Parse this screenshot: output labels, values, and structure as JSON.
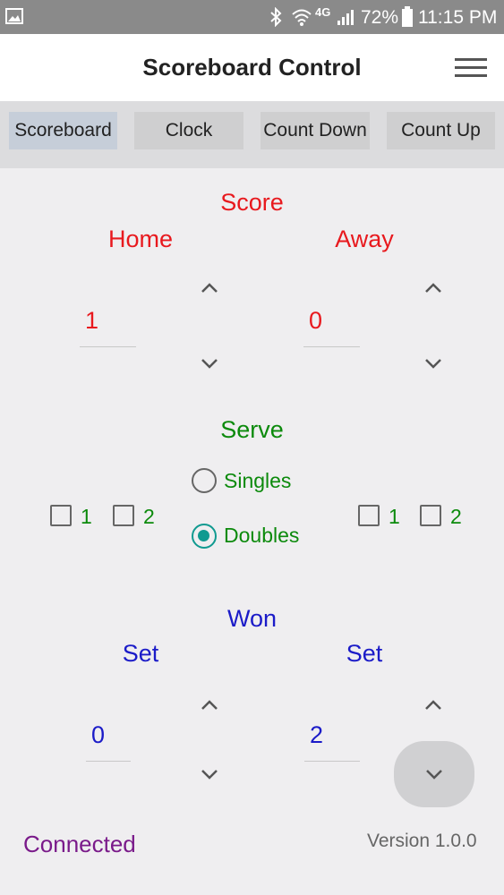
{
  "status_bar": {
    "icons": [
      "gallery-icon",
      "bluetooth-icon",
      "wifi-icon",
      "signal-4g-icon",
      "battery-icon"
    ],
    "network": "4G",
    "battery": "72%",
    "time": "11:15 PM"
  },
  "app_bar": {
    "title": "Scoreboard Control"
  },
  "tabs": [
    {
      "label": "Scoreboard",
      "active": true
    },
    {
      "label": "Clock",
      "active": false
    },
    {
      "label": "Count Down",
      "active": false
    },
    {
      "label": "Count Up",
      "active": false
    }
  ],
  "score": {
    "heading": "Score",
    "home_label": "Home",
    "away_label": "Away",
    "home_value": "1",
    "away_value": "0"
  },
  "serve": {
    "heading": "Serve",
    "singles_label": "Singles",
    "doubles_label": "Doubles",
    "selected": "Doubles",
    "home_checks": [
      {
        "label": "1",
        "checked": false
      },
      {
        "label": "2",
        "checked": false
      }
    ],
    "away_checks": [
      {
        "label": "1",
        "checked": false
      },
      {
        "label": "2",
        "checked": false
      }
    ]
  },
  "won": {
    "heading": "Won",
    "home_label": "Set",
    "away_label": "Set",
    "home_value": "0",
    "away_value": "2"
  },
  "footer": {
    "status": "Connected",
    "version": "Version 1.0.0"
  },
  "colors": {
    "score": "#e8191e",
    "serve": "#0c8a0c",
    "won": "#1b1bc8",
    "connected": "#7a1a8a",
    "radio_accent": "#109a90"
  }
}
